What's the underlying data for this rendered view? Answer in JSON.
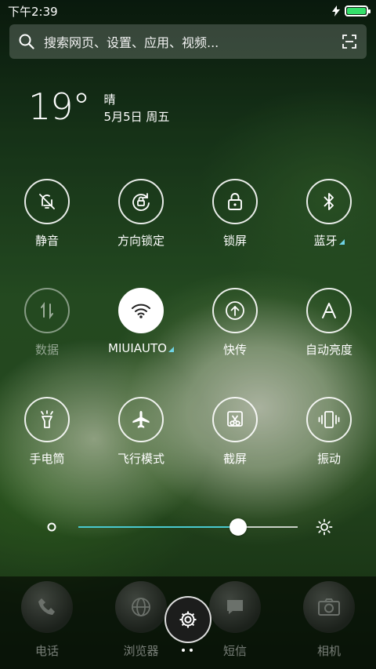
{
  "status_bar": {
    "time": "下午2:39",
    "battery_fraction": 1.0,
    "battery_color": "#34e06a"
  },
  "search": {
    "placeholder": "搜索网页、设置、应用、视频..."
  },
  "weather": {
    "temperature": "19°",
    "condition": "晴",
    "date": "5月5日 周五"
  },
  "toggles": [
    {
      "label": "静音",
      "icon": "bell-off-icon",
      "state": "inactive"
    },
    {
      "label": "方向锁定",
      "icon": "rotation-lock-icon",
      "state": "inactive"
    },
    {
      "label": "锁屏",
      "icon": "lock-icon",
      "state": "inactive"
    },
    {
      "label": "蓝牙",
      "icon": "bluetooth-icon",
      "state": "inactive",
      "has_more": true
    },
    {
      "label": "数据",
      "icon": "data-arrows-icon",
      "state": "disabled"
    },
    {
      "label": "MIUIAUTO",
      "icon": "wifi-icon",
      "state": "active",
      "has_more": true
    },
    {
      "label": "快传",
      "icon": "upload-icon",
      "state": "inactive"
    },
    {
      "label": "自动亮度",
      "icon": "letter-a-icon",
      "state": "inactive"
    },
    {
      "label": "手电筒",
      "icon": "flashlight-icon",
      "state": "inactive"
    },
    {
      "label": "飞行模式",
      "icon": "airplane-icon",
      "state": "inactive"
    },
    {
      "label": "截屏",
      "icon": "screenshot-icon",
      "state": "inactive"
    },
    {
      "label": "振动",
      "icon": "vibrate-icon",
      "state": "inactive"
    }
  ],
  "brightness": {
    "level": 0.73,
    "accent": "#49c9cf"
  },
  "dock": [
    {
      "label": "电话",
      "icon": "phone-icon"
    },
    {
      "label": "浏览器",
      "icon": "browser-icon"
    },
    {
      "label": "短信",
      "icon": "message-icon"
    },
    {
      "label": "相机",
      "icon": "camera-icon"
    }
  ],
  "settings_button": {
    "icon": "gear-icon"
  },
  "pager": {
    "pages": 2,
    "current": 0
  }
}
